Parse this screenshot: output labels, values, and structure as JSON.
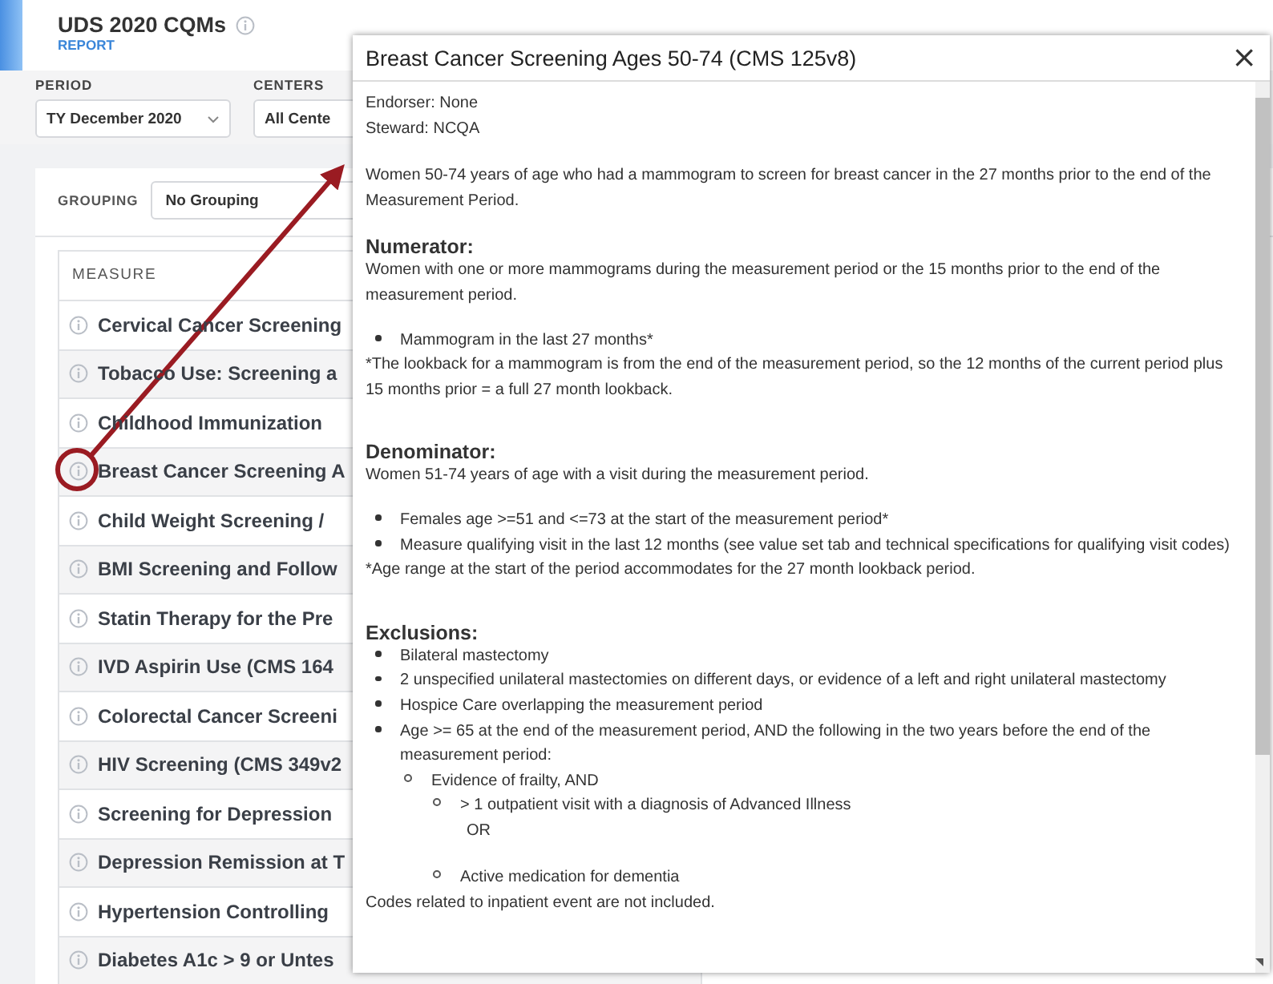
{
  "app": {
    "title": "UDS 2020 CQMs",
    "subtitle": "REPORT"
  },
  "filters": [
    {
      "label": "PERIOD",
      "value": "TY December 2020"
    },
    {
      "label": "CENTERS",
      "value": "All Cente"
    }
  ],
  "grouping": {
    "label": "GROUPING",
    "value": "No Grouping"
  },
  "table": {
    "columns": [
      "MEASURE"
    ],
    "rows": [
      {
        "measure": "Cervical Cancer Screening"
      },
      {
        "measure": "Tobacco Use: Screening a"
      },
      {
        "measure": "Childhood Immunization"
      },
      {
        "measure": "Breast Cancer Screening A"
      },
      {
        "measure": "Child Weight Screening /"
      },
      {
        "measure": "BMI Screening and Follow"
      },
      {
        "measure": "Statin Therapy for the Pre"
      },
      {
        "measure": "IVD Aspirin Use (CMS 164"
      },
      {
        "measure": "Colorectal Cancer Screeni"
      },
      {
        "measure": "HIV Screening (CMS 349v2"
      },
      {
        "measure": "Screening for Depression"
      },
      {
        "measure": "Depression Remission at T"
      },
      {
        "measure": "Hypertension Controlling"
      },
      {
        "measure": "Diabetes A1c > 9 or Untes"
      }
    ]
  },
  "dialog": {
    "title": "Breast Cancer Screening Ages 50-74 (CMS 125v8)",
    "close": "×",
    "blocks": [
      {
        "kind": "para",
        "lines": [
          "Endorser: None",
          "Steward: NCQA"
        ]
      },
      {
        "kind": "para",
        "lines": [
          "Women 50-74 years of age who had a mammogram to screen for breast cancer in the 27 months prior to the end of the Measurement Period."
        ]
      },
      {
        "kind": "heading",
        "text": "Numerator:"
      },
      {
        "kind": "para",
        "lines": [
          "Women with one or more mammograms during the measurement period or the 15 months prior to the end of the measurement period."
        ]
      },
      {
        "kind": "list",
        "items": [
          {
            "text": "Mammogram in the last 27 months*"
          }
        ]
      },
      {
        "kind": "note",
        "lines": [
          "*The lookback for a mammogram is from the end of the measurement period, so the 12 months of the current period plus 15 months prior = a full 27 month lookback."
        ]
      },
      {
        "kind": "heading",
        "text": "Denominator:"
      },
      {
        "kind": "para",
        "lines": [
          "Women 51-74 years of age with a visit during the measurement period."
        ]
      },
      {
        "kind": "list",
        "items": [
          {
            "text": "Females age >=51 and <=73 at the start of the measurement period*"
          },
          {
            "text": "Measure qualifying visit in the last 12 months (see value set tab and technical specifications for qualifying visit codes)"
          }
        ]
      },
      {
        "kind": "note",
        "lines": [
          "*Age range at the start of the period accommodates for the 27 month lookback period."
        ]
      },
      {
        "kind": "heading",
        "text": "Exclusions:"
      },
      {
        "kind": "list",
        "items": [
          {
            "text": "Bilateral mastectomy"
          },
          {
            "text": "2 unspecified unilateral mastectomies on different days, or evidence of a left and right unilateral mastectomy"
          },
          {
            "text": "Hospice Care overlapping the measurement period"
          },
          {
            "text": "Age >= 65 at the end of the measurement period, AND the following in the two years before the end of the measurement period:",
            "children": [
              {
                "text": "Evidence of frailty, AND",
                "children": [
                  {
                    "text": "> 1 outpatient visit with a diagnosis of Advanced Illness",
                    "after": "OR"
                  },
                  {
                    "text": "Active medication for dementia"
                  }
                ]
              }
            ]
          }
        ]
      },
      {
        "kind": "plain",
        "lines": [
          "Codes related to inpatient event are not included."
        ]
      }
    ]
  }
}
